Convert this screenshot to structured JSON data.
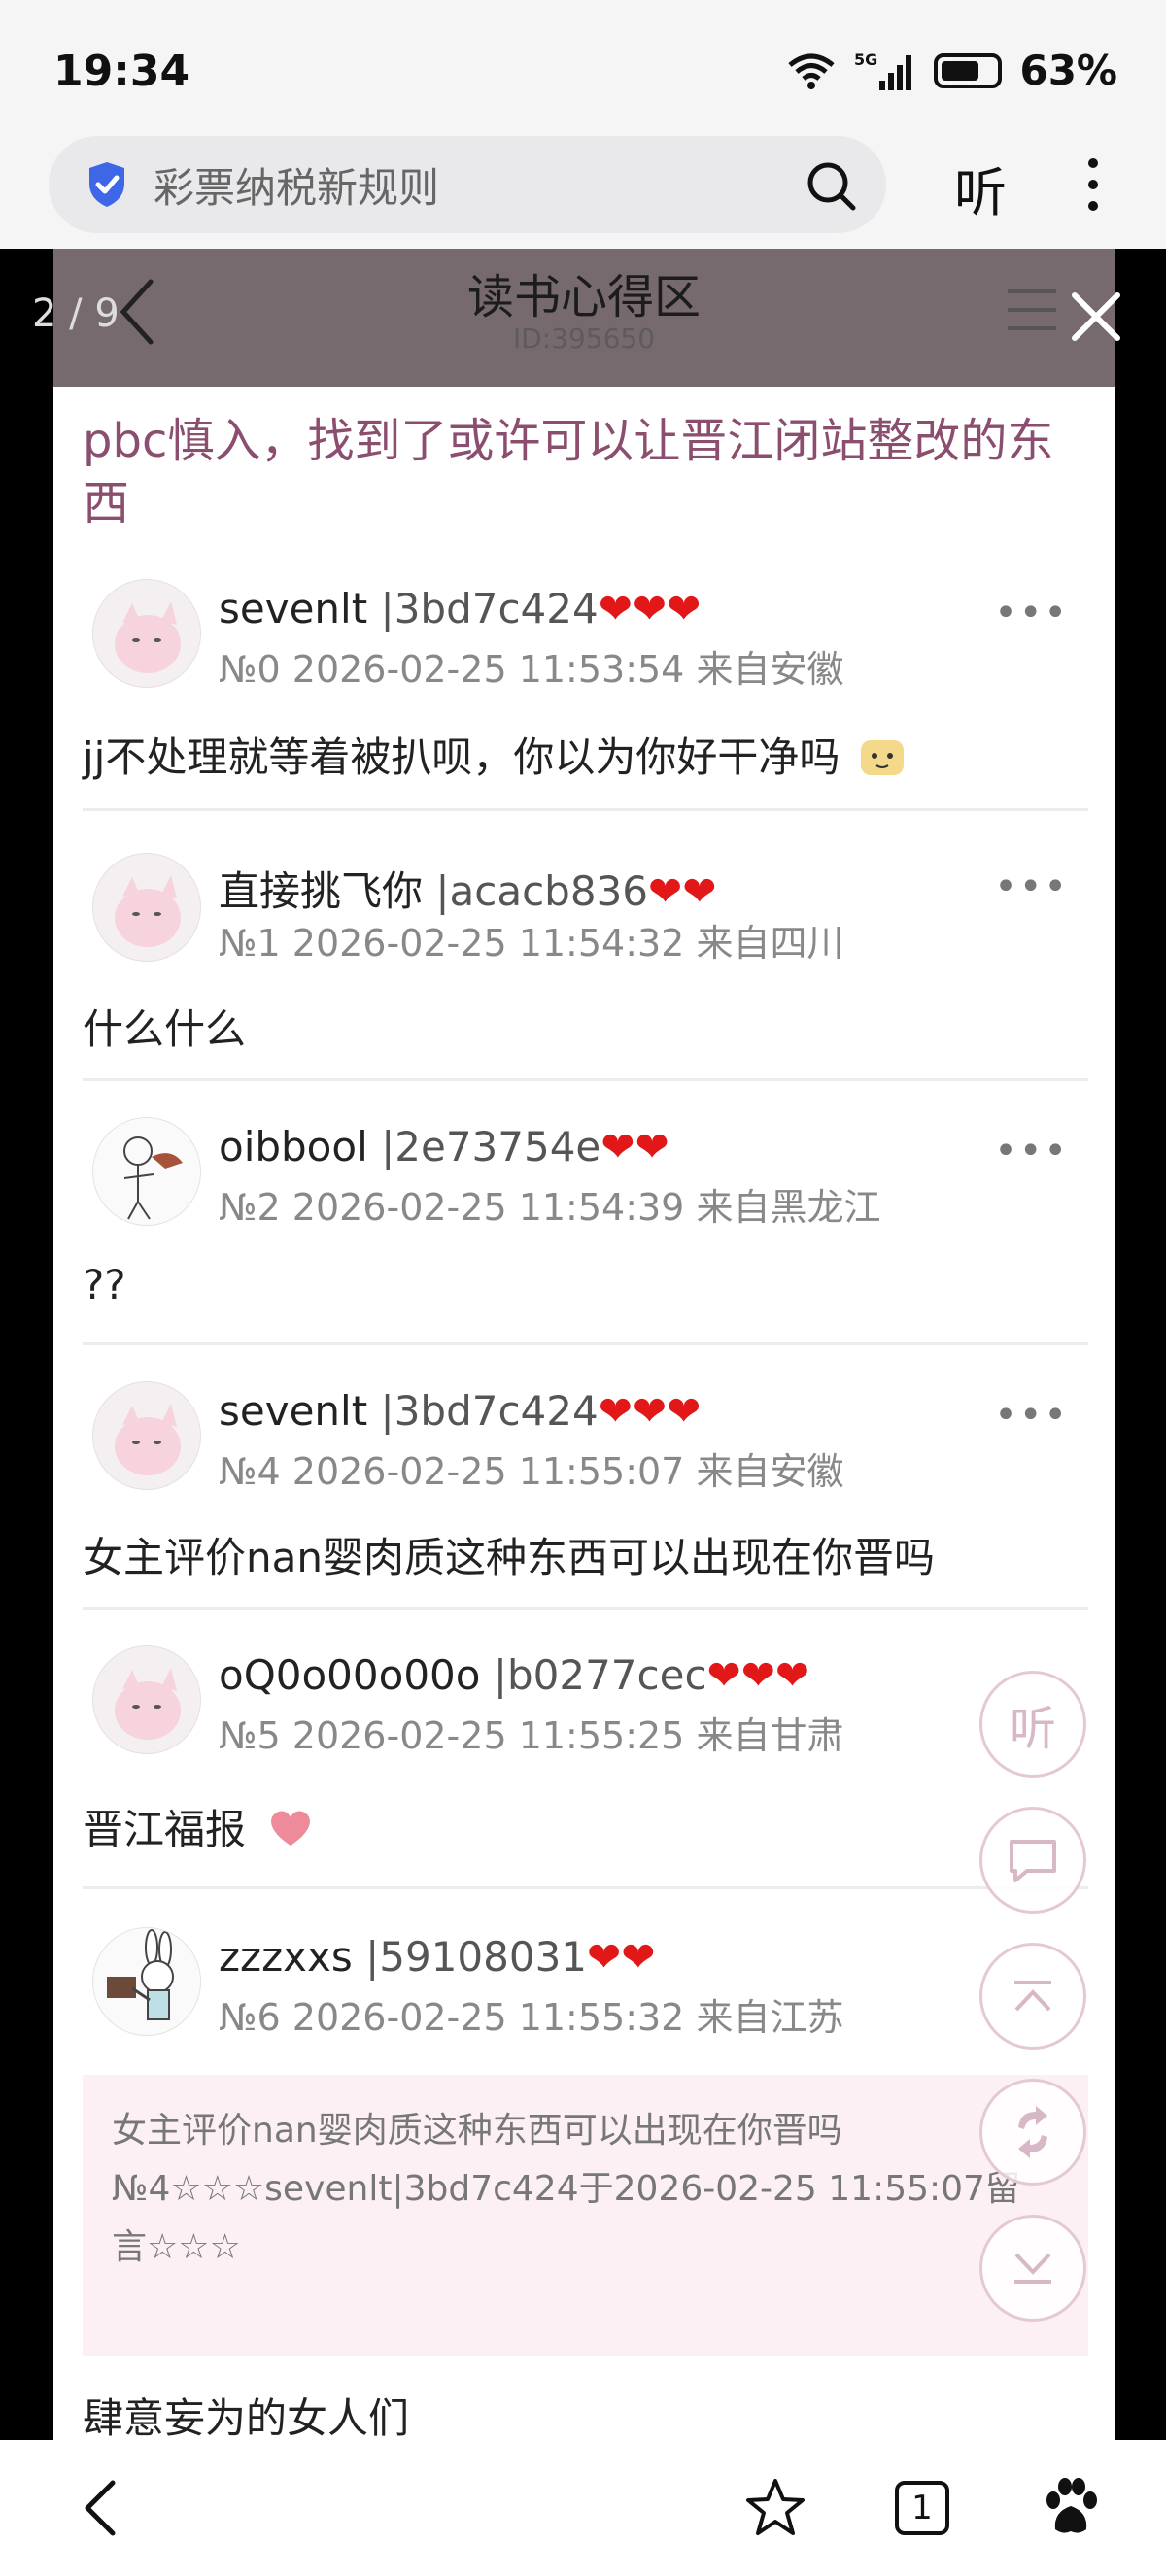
{
  "status": {
    "time": "19:34",
    "network": "5G",
    "battery": "63%"
  },
  "browser": {
    "search_text": "彩票纳税新规则",
    "listen_label": "听"
  },
  "reader": {
    "page_counter": "2 / 9",
    "title": "读书心得区",
    "id_text": "ID:395650",
    "topic_title": "pbc慎入，找到了或许可以让晋江闭站整改的东西"
  },
  "posts": [
    {
      "name": "sevenlt",
      "uid": "|3bd7c424",
      "hearts": "❤❤❤",
      "meta": "№0 2026-02-25 11:53:54 来自安徽",
      "content": "jj不处理就等着被扒呗，你以为你好干净吗"
    },
    {
      "name": "直接挑飞你",
      "uid": "|acacb836",
      "hearts": "❤❤",
      "meta": "№1 2026-02-25 11:54:32 来自四川",
      "content": "什么什么"
    },
    {
      "name": "oibbool",
      "uid": "|2e73754e",
      "hearts": "❤❤",
      "meta": "№2 2026-02-25 11:54:39 来自黑龙江",
      "content": "??"
    },
    {
      "name": "sevenlt",
      "uid": "|3bd7c424",
      "hearts": "❤❤❤",
      "meta": "№4 2026-02-25 11:55:07 来自安徽",
      "content": "女主评价nan婴肉质这种东西可以出现在你晋吗"
    },
    {
      "name": "oQ0o00o00o",
      "uid": "|b0277cec",
      "hearts": "❤❤❤",
      "meta": "№5 2026-02-25 11:55:25 来自甘肃",
      "content": "晋江福报"
    },
    {
      "name": "zzzxxs",
      "uid": "|59108031",
      "hearts": "❤❤",
      "meta": "№6 2026-02-25 11:55:32 来自江苏",
      "content": ""
    }
  ],
  "quote": {
    "line1": "女主评价nan婴肉质这种东西可以出现在你晋吗",
    "line2": "№4☆☆☆sevenlt|3bd7c424于2026-02-25 11:55:07留",
    "line3": "言☆☆☆"
  },
  "last_line": "肆意妄为的女人们",
  "floating": {
    "listen": "听"
  },
  "bottom": {
    "tab_count": "1"
  }
}
